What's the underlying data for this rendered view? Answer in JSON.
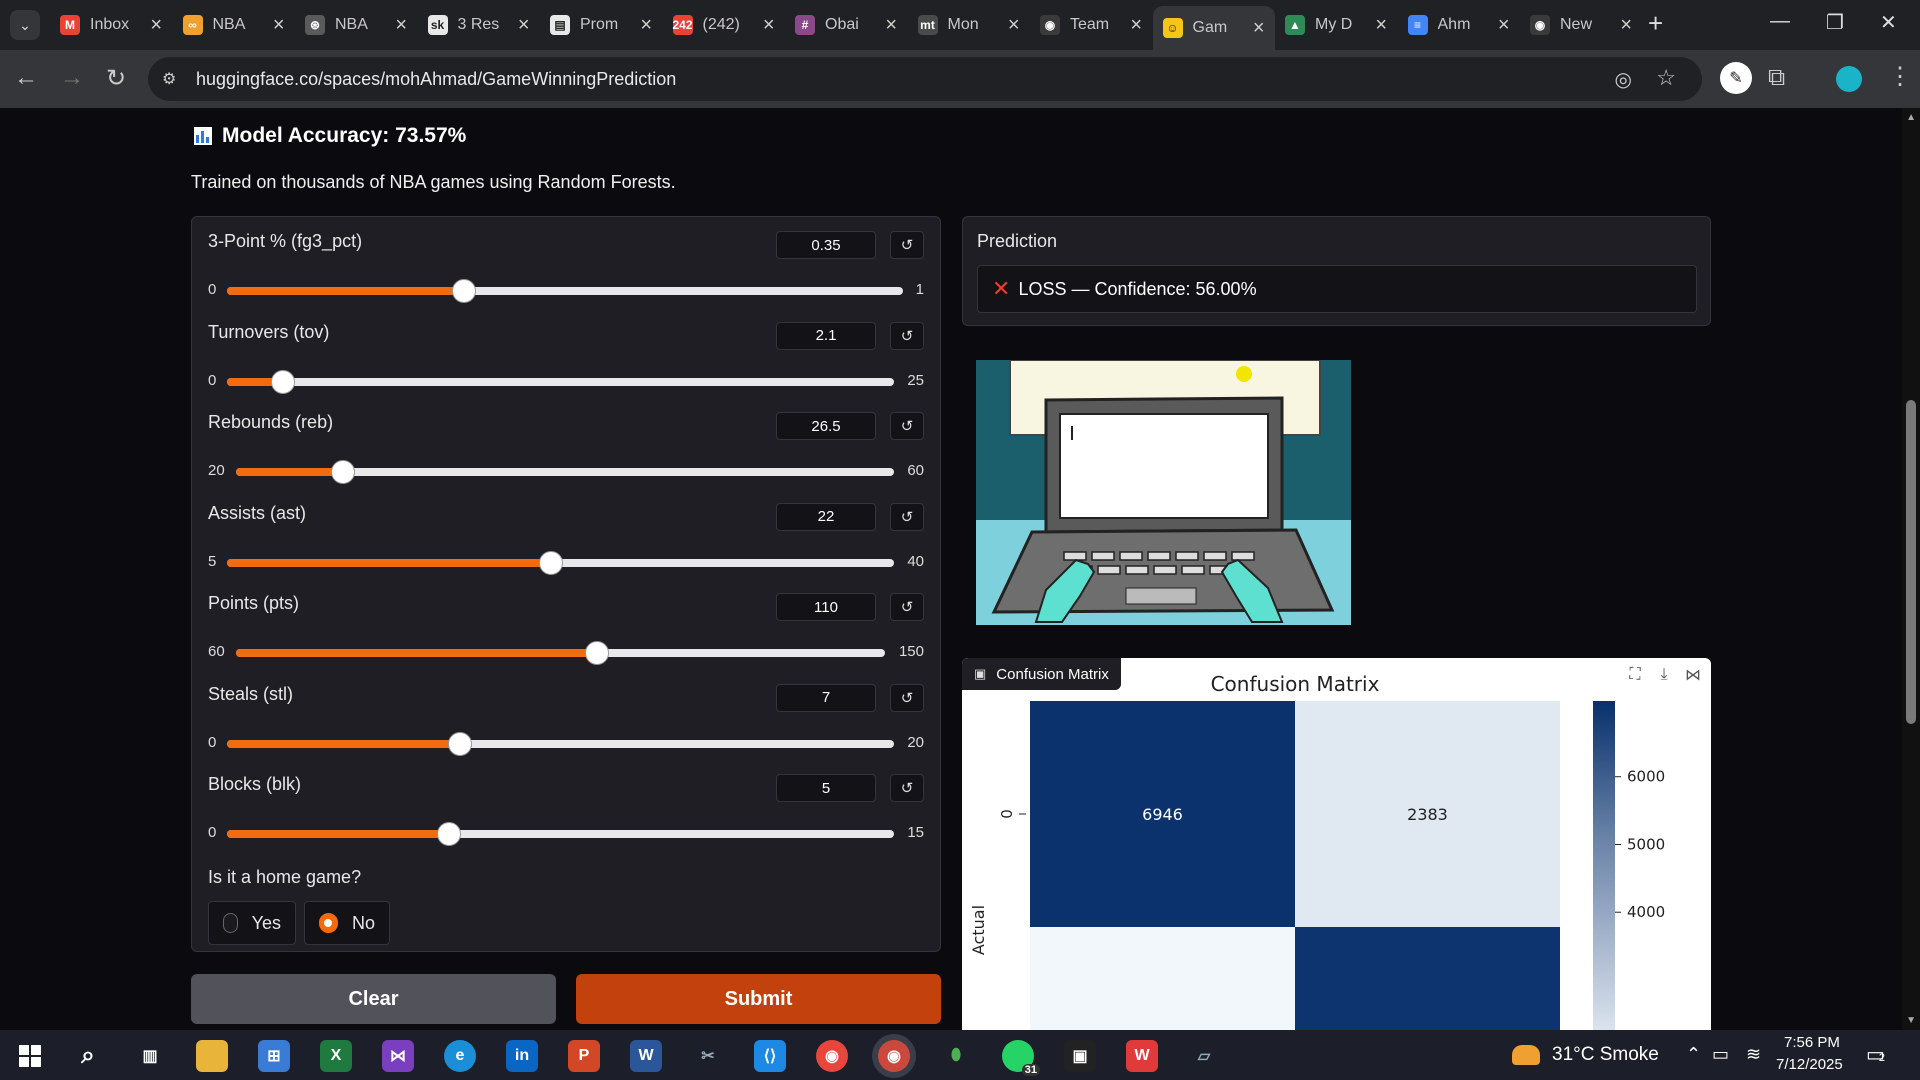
{
  "browser": {
    "tabs": [
      {
        "label": "Inbox",
        "icon": "gmail-icon",
        "color": "#ea4335",
        "glyph": "M"
      },
      {
        "label": "NBA",
        "icon": "infinity-icon",
        "color": "#f0a030",
        "glyph": "∞"
      },
      {
        "label": "NBA",
        "icon": "openai-icon",
        "color": "#5a5a5a",
        "glyph": "⊛"
      },
      {
        "label": "3 Res",
        "icon": "sk-icon",
        "color": "#e8e8e8",
        "glyph": "sk"
      },
      {
        "label": "Prom",
        "icon": "doc-icon",
        "color": "#e8e8e8",
        "glyph": "▤"
      },
      {
        "label": "(242)",
        "icon": "youtube-icon",
        "color": "#ea4335",
        "glyph": "242"
      },
      {
        "label": "Obai",
        "icon": "slack-icon",
        "color": "#8a4a8a",
        "glyph": "#"
      },
      {
        "label": "Mon",
        "icon": "mt-icon",
        "color": "#4a4a4a",
        "glyph": "mt"
      },
      {
        "label": "Team",
        "icon": "github-icon",
        "color": "#3a3a3a",
        "glyph": "◉"
      },
      {
        "label": "Gam",
        "icon": "huggingface-icon",
        "color": "#f5c518",
        "glyph": "☺"
      },
      {
        "label": "My D",
        "icon": "drive-icon",
        "color": "#2e8b57",
        "glyph": "▲"
      },
      {
        "label": "Ahm",
        "icon": "docs-icon",
        "color": "#4285f4",
        "glyph": "≡"
      },
      {
        "label": "New",
        "icon": "github-icon",
        "color": "#3a3a3a",
        "glyph": "◉"
      }
    ],
    "url": "huggingface.co/spaces/mohAhmad/GameWinningPrediction"
  },
  "app": {
    "accuracy_label": "Model Accuracy: 73.57%",
    "subtitle": "Trained on thousands of NBA games using Random Forests.",
    "sliders": [
      {
        "label": "3-Point % (fg3_pct)",
        "value": "0.35",
        "min": "0",
        "max": "1",
        "fraction": 0.35
      },
      {
        "label": "Turnovers (tov)",
        "value": "2.1",
        "min": "0",
        "max": "25",
        "fraction": 0.084
      },
      {
        "label": "Rebounds (reb)",
        "value": "26.5",
        "min": "20",
        "max": "60",
        "fraction": 0.1625
      },
      {
        "label": "Assists (ast)",
        "value": "22",
        "min": "5",
        "max": "40",
        "fraction": 0.4857
      },
      {
        "label": "Points (pts)",
        "value": "110",
        "min": "60",
        "max": "150",
        "fraction": 0.5556
      },
      {
        "label": "Steals (stl)",
        "value": "7",
        "min": "0",
        "max": "20",
        "fraction": 0.35
      },
      {
        "label": "Blocks (blk)",
        "value": "5",
        "min": "0",
        "max": "15",
        "fraction": 0.3333
      }
    ],
    "home_game": {
      "label": "Is it a home game?",
      "options": [
        "Yes",
        "No"
      ],
      "selected": "No"
    },
    "buttons": {
      "clear": "Clear",
      "submit": "Submit"
    },
    "prediction": {
      "label": "Prediction",
      "result": "LOSS — Confidence: 56.00%"
    },
    "confusion_tag": "Confusion Matrix",
    "reset_glyph": "↺"
  },
  "chart_data": {
    "type": "heatmap",
    "title": "Confusion Matrix",
    "ylabel": "Actual",
    "row_labels": [
      "0"
    ],
    "cells": [
      [
        6946,
        2383
      ]
    ],
    "colorbar_ticks": [
      6000,
      5000,
      4000
    ],
    "colormap": "Blues"
  },
  "taskbar": {
    "weather": "31°C Smoke",
    "time": "7:56 PM",
    "date": "7/12/2025",
    "whatsapp_badge": "31",
    "notif_badge": "2"
  },
  "colors": {
    "accent": "#f26b0f",
    "submit": "#c2410c",
    "loss": "#ef3b2c"
  }
}
